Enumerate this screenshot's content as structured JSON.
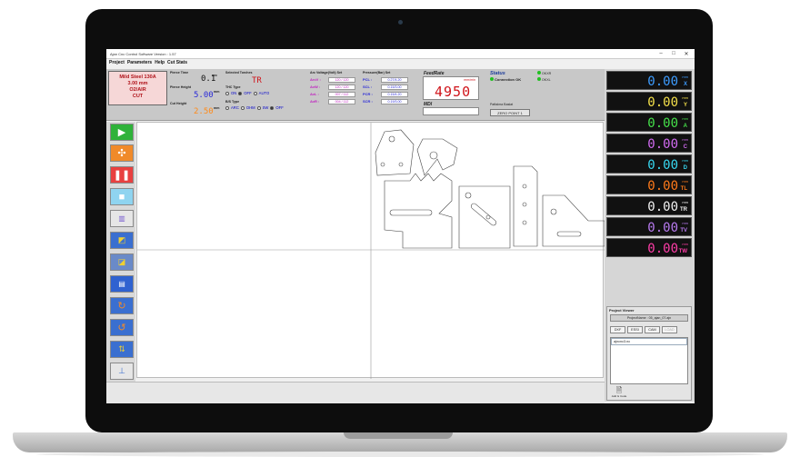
{
  "window": {
    "title": "Ajan Cnc Control Software Version : 1.57"
  },
  "menu": [
    "Project",
    "Parameters",
    "Help",
    "Cut Stats"
  ],
  "material": {
    "line1": "Mild Steel 130A",
    "line2": "3.00 mm",
    "line3": "O2/AIR",
    "line4": "CUT"
  },
  "pierce": {
    "time_label": "Pierce Time",
    "time_value": "0.1",
    "time_unit": "sec",
    "height_label": "Pierce Height",
    "height_value": "5.00",
    "height_unit": "mm",
    "cut_label": "Cut Height",
    "cut_value": "2.50",
    "cut_unit": "mm"
  },
  "torch": {
    "label": "Selected Torches",
    "value": "TR"
  },
  "thc": {
    "label": "THC Type",
    "options": [
      "ON",
      "OFF",
      "AUTO"
    ],
    "selected": "OFF"
  },
  "bs": {
    "label": "B/S Type",
    "options": [
      "ARC",
      "OHM",
      "SW",
      "OFF"
    ],
    "selected": "OFF"
  },
  "arc": {
    "title": "Arc Voltage(Volt) Set",
    "rows": [
      {
        "k": "ArcV :",
        "v": "120 / 120"
      },
      {
        "k": "AvW :",
        "v": "120 / 120"
      },
      {
        "k": "AvL :",
        "v": "007 / 112"
      },
      {
        "k": "AvR :",
        "v": "004 / 112"
      }
    ]
  },
  "pressure": {
    "title": "Pressure(Bar) Set",
    "rows": [
      {
        "k": "PCL :",
        "v": "0.27/4.20"
      },
      {
        "k": "SCL :",
        "v": "0.15/3.00"
      },
      {
        "k": "PCR :",
        "v": "0.15/4.20"
      },
      {
        "k": "SCR :",
        "v": "0.19/3.00"
      }
    ]
  },
  "feed": {
    "label": "FeedRate",
    "unit": "mm/min",
    "value": "4950"
  },
  "mdi": {
    "label": "MDI",
    "value": ""
  },
  "status": {
    "label": "Status",
    "connection": "Connection OK",
    "mode_label": "Paftalma Baslat",
    "zero_point": "ZERO POINT 1"
  },
  "ind": {
    "a": "OKXR",
    "b": "OKXL"
  },
  "axes": [
    {
      "name": "X",
      "value": "0.00",
      "unit": "mm",
      "color": "#3d9cff"
    },
    {
      "name": "Y",
      "value": "0.00",
      "unit": "mm",
      "color": "#f4e04a"
    },
    {
      "name": "A",
      "value": "0.00",
      "unit": "mm",
      "color": "#45e04a"
    },
    {
      "name": "C",
      "value": "0.00",
      "unit": "mm",
      "color": "#d06af0"
    },
    {
      "name": "D",
      "value": "0.00",
      "unit": "mm",
      "color": "#37d7f0"
    },
    {
      "name": "TL",
      "value": "0.00",
      "unit": "mm",
      "color": "#ff7a1a"
    },
    {
      "name": "TR",
      "value": "0.00",
      "unit": "mm",
      "color": "#f2f2f2"
    },
    {
      "name": "TV",
      "value": "0.00",
      "unit": "mm",
      "color": "#b87af0"
    },
    {
      "name": "TW",
      "value": "0.00",
      "unit": "mm",
      "color": "#ff3da8"
    }
  ],
  "project": {
    "title": "Project Viewer",
    "name": "ProjectName : 05_ajan_07.ajn",
    "buttons": [
      "DXF",
      "ESSI",
      "CAM",
      "LOAD"
    ],
    "files": [
      "ajncnc3.nc"
    ],
    "add_label": "Add G Code"
  },
  "colors": {
    "accent_red": "#d0141a",
    "accent_blue": "#2a2ad8",
    "accent_orange": "#ff8a18"
  }
}
